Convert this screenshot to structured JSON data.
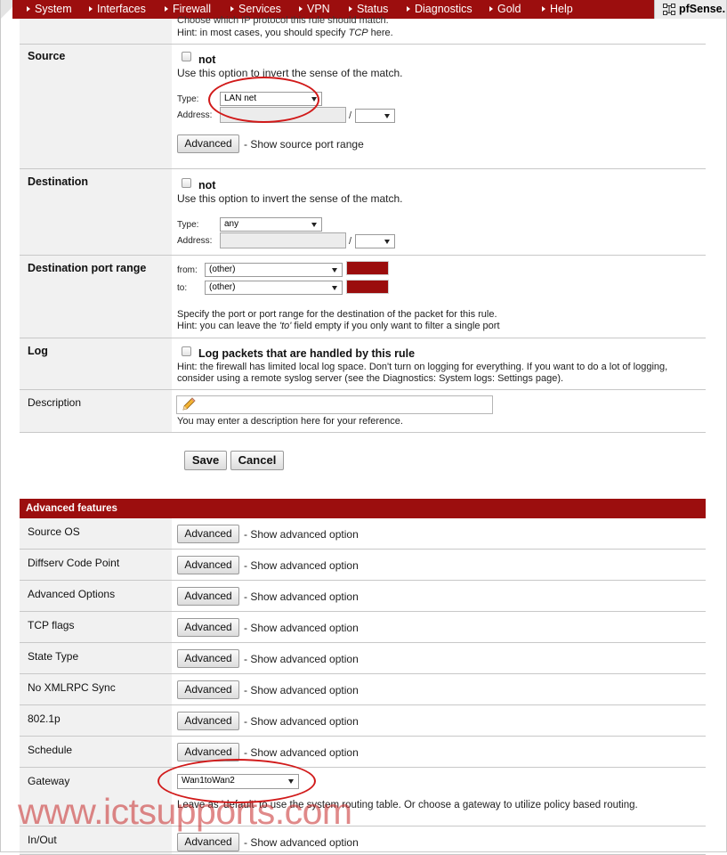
{
  "nav": {
    "items": [
      "System",
      "Interfaces",
      "Firewall",
      "Services",
      "VPN",
      "Status",
      "Diagnostics",
      "Gold",
      "Help"
    ],
    "logo_text": "pfSense."
  },
  "protocol_hint": {
    "line1": "Choose which IP protocol this rule should match.",
    "line2_prefix": "Hint: in most cases, you should specify ",
    "line2_em": "TCP",
    "line2_suffix": " here."
  },
  "source": {
    "label": "Source",
    "not_label": "not",
    "invert_hint": "Use this option to invert the sense of the match.",
    "type_label": "Type:",
    "type_value": "LAN net",
    "address_label": "Address:",
    "slash": "/",
    "advanced_button": "Advanced",
    "advanced_desc": "- Show source port range"
  },
  "destination": {
    "label": "Destination",
    "not_label": "not",
    "invert_hint": "Use this option to invert the sense of the match.",
    "type_label": "Type:",
    "type_value": "any",
    "address_label": "Address:",
    "slash": "/"
  },
  "dest_port": {
    "label": "Destination port range",
    "from_label": "from:",
    "from_value": "(other)",
    "to_label": "to:",
    "to_value": "(other)",
    "hint1": "Specify the port or port range for the destination of the packet for this rule.",
    "hint2_prefix": "Hint: you can leave the ",
    "hint2_em": "'to'",
    "hint2_suffix": " field empty if you only want to filter a single port"
  },
  "log": {
    "label": "Log",
    "checkbox_label": "Log packets that are handled by this rule",
    "hint1": "Hint: the firewall has limited local log space. Don't turn on logging for everything. If you want to do a lot of logging,",
    "hint2": "consider using a remote syslog server (see the Diagnostics: System logs: Settings page)."
  },
  "description": {
    "label": "Description",
    "value": "",
    "hint": "You may enter a description here for your reference."
  },
  "actions": {
    "save": "Save",
    "cancel": "Cancel"
  },
  "advanced": {
    "header": "Advanced features",
    "button_label": "Advanced",
    "option_desc": "- Show advanced option",
    "rows": [
      "Source OS",
      "Diffserv Code Point",
      "Advanced Options",
      "TCP flags",
      "State Type",
      "No XMLRPC Sync",
      "802.1p",
      "Schedule"
    ],
    "gateway_label": "Gateway",
    "gateway_value": "Wan1toWan2",
    "gateway_hint": "Leave as 'default' to use the system routing table. Or choose a gateway to utilize policy based routing.",
    "inout_label": "In/Out"
  },
  "watermark": "www.ictsupports.com",
  "colors": {
    "brand_red": "#9c0e0e",
    "annotation_red": "#d11a1a"
  }
}
